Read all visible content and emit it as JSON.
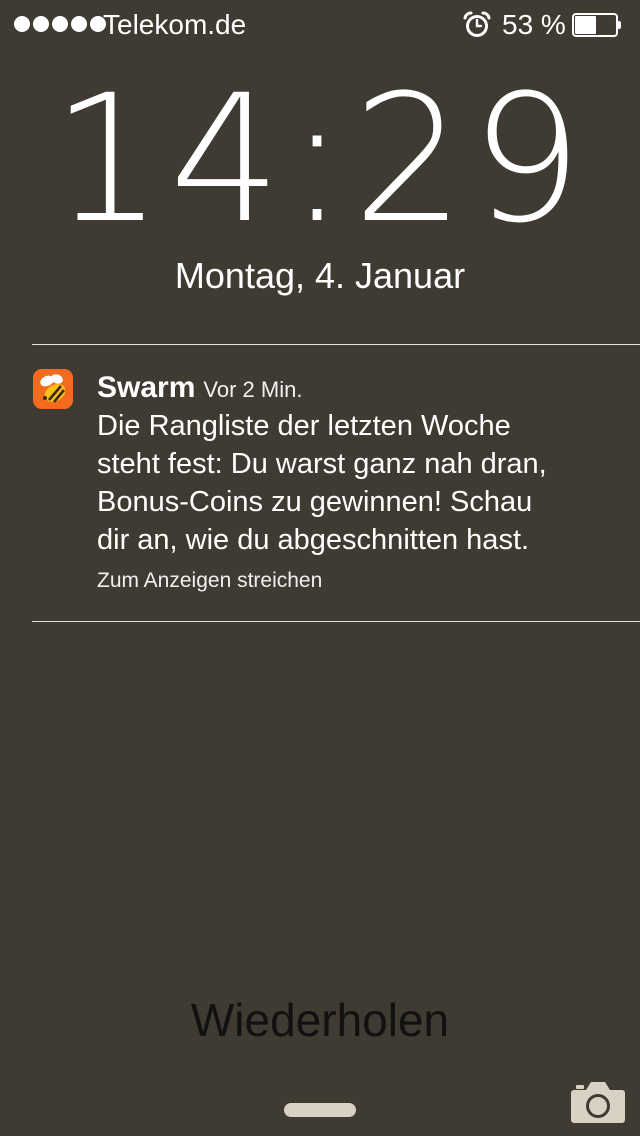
{
  "status_bar": {
    "carrier": "Telekom.de",
    "signal_dots": 5,
    "alarm_icon": "alarm-clock-icon",
    "battery_percent_text": "53 %",
    "battery_level": 0.53
  },
  "lock": {
    "time": "14:29",
    "date": "Montag, 4. Januar"
  },
  "notification": {
    "app_name": "Swarm",
    "app_icon": "swarm-bee-icon",
    "time_ago": "Vor 2 Min.",
    "body": "Die Rangliste der letzten Woche\nsteht fest: Du warst ganz nah dran,\nBonus-Coins zu gewinnen! Schau\ndir an, wie du abgeschnitten hast.",
    "hint": "Zum Anzeigen streichen",
    "accent_color": "#f46b20"
  },
  "bottom": {
    "retry_label": "Wiederholen",
    "camera_icon": "camera-icon"
  },
  "colors": {
    "background": "#3f3b32",
    "text": "#ffffff",
    "retry_text": "#111111"
  }
}
